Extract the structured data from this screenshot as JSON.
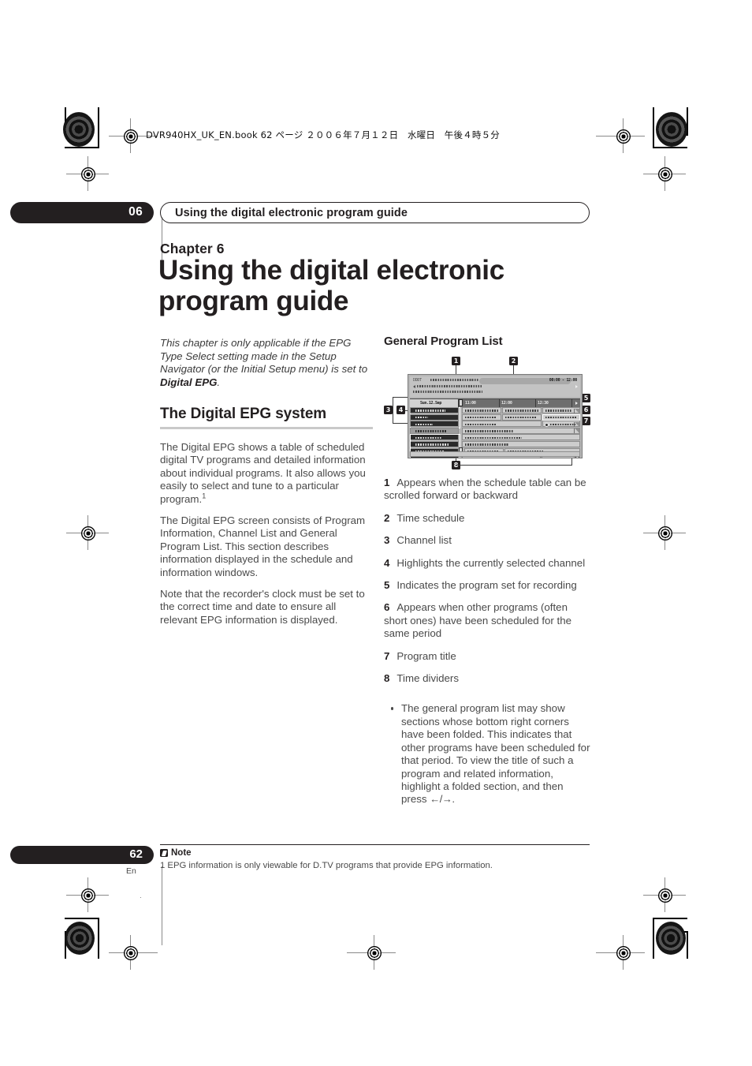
{
  "header": {
    "file_info": "DVR940HX_UK_EN.book  62 ページ  ２００６年７月１２日　水曜日　午後４時５分"
  },
  "running_head": {
    "chapter_number": "06",
    "title": "Using the digital electronic program guide"
  },
  "chapter": {
    "label": "Chapter 6",
    "title": "Using the digital electronic program guide"
  },
  "left_column": {
    "lead_pre": "This chapter is only applicable if the EPG Type Select setting made in the Setup Navigator (or the Initial Setup menu) is set to ",
    "lead_bold": "Digital EPG",
    "lead_post": ".",
    "section_title": "The Digital EPG system",
    "paragraph_1": "The Digital EPG shows a table of scheduled digital TV programs and detailed information about individual programs. It also allows you easily to select and tune to a particular program.",
    "paragraph_1_footnote": "1",
    "paragraph_2": "The Digital EPG screen consists of Program Information, Channel List and General Program List. This section describes information displayed in the schedule and information windows.",
    "paragraph_3": "Note that the recorder's clock must be set to the correct time and date to ensure all relevant EPG information is displayed."
  },
  "right_column": {
    "subsection_title": "General Program List",
    "legend": [
      {
        "num": "1",
        "text": "Appears when the schedule table can be scrolled forward or backward"
      },
      {
        "num": "2",
        "text": "Time schedule"
      },
      {
        "num": "3",
        "text": "Channel list"
      },
      {
        "num": "4",
        "text": "Highlights the currently selected channel"
      },
      {
        "num": "5",
        "text": "Indicates the program set for recording"
      },
      {
        "num": "6",
        "text": "Appears when other programs (often short ones) have been scheduled for the same period"
      },
      {
        "num": "7",
        "text": "Program title"
      },
      {
        "num": "8",
        "text": "Time dividers"
      }
    ],
    "bullet_pre": "The general program list may show sections whose bottom right corners have been folded. This indicates that other programs have been scheduled for that period. To view the title of such a program and related information, highlight a folded section, and then press ",
    "bullet_arrows": "←/→",
    "bullet_post": "."
  },
  "figure": {
    "name": "general-program-list-screenshot",
    "clock": "00:00 - 12:00",
    "day_label": "Sun.12.Sep",
    "time_labels": [
      "11:00",
      "12:00",
      "12:30"
    ],
    "callouts": [
      "1",
      "2",
      "3",
      "4",
      "5",
      "6",
      "7",
      "8"
    ]
  },
  "footer": {
    "page_number": "62",
    "language": "En",
    "note_label": "Note",
    "note_text": "1 EPG information is only viewable for D.TV programs that provide EPG information."
  },
  "colors": {
    "ink": "#231f20",
    "body_text": "#4a4a4a",
    "rule": "#c9c9c9"
  }
}
